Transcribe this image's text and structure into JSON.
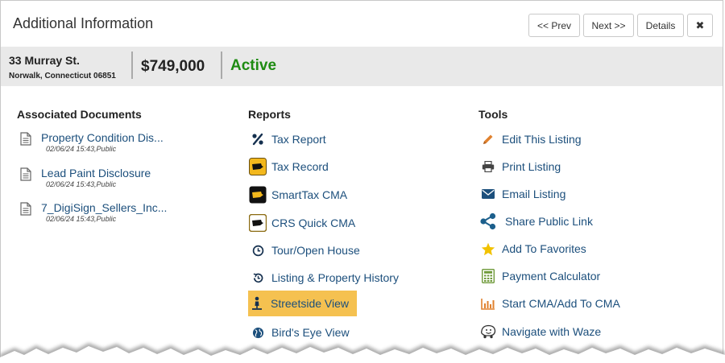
{
  "dialog": {
    "title": "Additional Information",
    "buttons": {
      "prev": "<< Prev",
      "next": "Next >>",
      "details": "Details",
      "close": "✖"
    }
  },
  "listing": {
    "street": "33 Murray St.",
    "city_line": "Norwalk, Connecticut 06851",
    "price": "$749,000",
    "status": "Active",
    "status_color": "#1e8b12"
  },
  "sections": {
    "documents": {
      "heading": "Associated Documents",
      "items": [
        {
          "label": "Property Condition Dis...",
          "meta": "02/06/24 15:43,Public",
          "icon": "document-icon"
        },
        {
          "label": "Lead Paint Disclosure",
          "meta": "02/06/24 15:43,Public",
          "icon": "document-icon"
        },
        {
          "label": "7_DigiSign_Sellers_Inc...",
          "meta": "02/06/24 15:43,Public",
          "icon": "document-icon"
        }
      ]
    },
    "reports": {
      "heading": "Reports",
      "items": [
        {
          "label": "Tax Report",
          "icon": "percent-icon"
        },
        {
          "label": "Tax Record",
          "icon": "ct-map-icon"
        },
        {
          "label": "SmartTax CMA",
          "icon": "ct-map-dark-icon"
        },
        {
          "label": "CRS Quick CMA",
          "icon": "ct-map-outline-icon"
        },
        {
          "label": "Tour/Open House",
          "icon": "clock-icon"
        },
        {
          "label": "Listing & Property History",
          "icon": "history-icon"
        },
        {
          "label": "Streetside View",
          "icon": "street-person-icon",
          "highlighted": true
        },
        {
          "label": "Bird's Eye View",
          "icon": "globe-icon"
        }
      ]
    },
    "tools": {
      "heading": "Tools",
      "items": [
        {
          "label": "Edit This Listing",
          "icon": "pencil-icon"
        },
        {
          "label": "Print Listing",
          "icon": "printer-icon"
        },
        {
          "label": "Email Listing",
          "icon": "envelope-icon"
        },
        {
          "label": "Share Public Link",
          "icon": "share-icon"
        },
        {
          "label": "Add To Favorites",
          "icon": "star-icon"
        },
        {
          "label": "Payment Calculator",
          "icon": "calculator-icon"
        },
        {
          "label": "Start CMA/Add To CMA",
          "icon": "bar-chart-icon"
        },
        {
          "label": "Navigate with Waze",
          "icon": "waze-icon"
        }
      ]
    }
  },
  "colors": {
    "link": "#1c4f7c",
    "highlight": "#f5c150",
    "infobar": "#e9e9e9",
    "accent_orange": "#e0812e",
    "accent_navy": "#1c4f7c",
    "star": "#f2c200",
    "calc_green": "#6f9a3a"
  }
}
